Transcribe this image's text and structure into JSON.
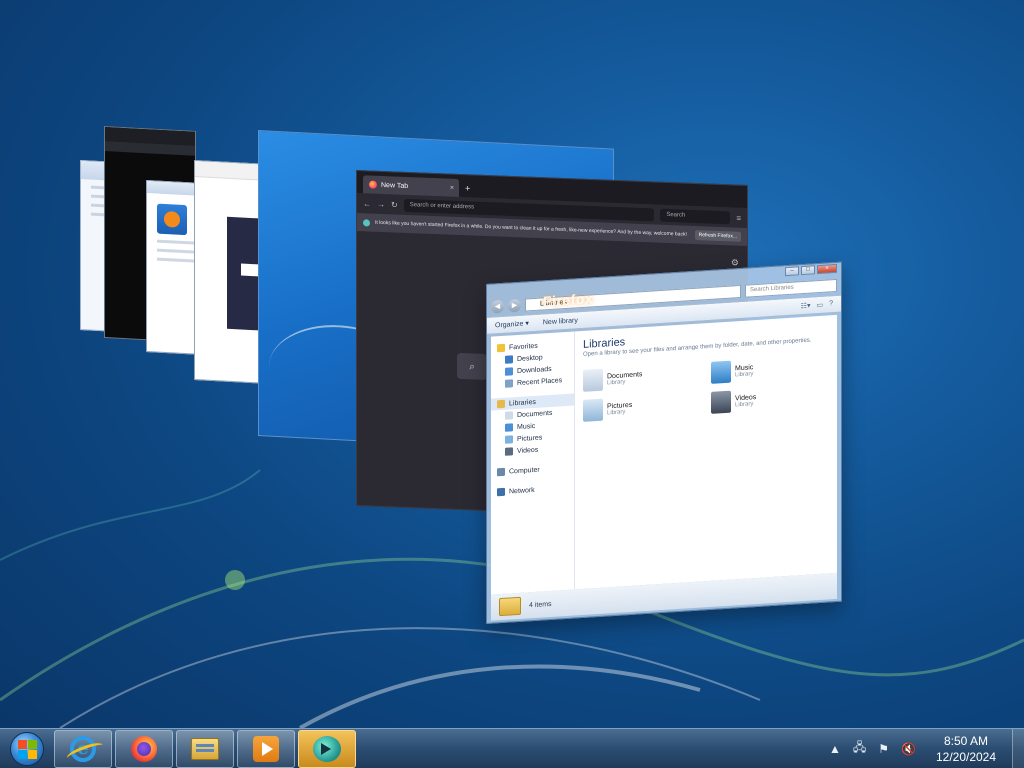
{
  "firefox_window": {
    "tab_title": "New Tab",
    "tab_close": "×",
    "new_tab": "+",
    "address_placeholder": "Search or enter address",
    "search_placeholder": "Search",
    "notification_text": "It looks like you haven't started Firefox in a while. Do you want to clean it up for a fresh, like-new experience? And by the way, welcome back!",
    "notification_button": "Refresh Firefox..."
  },
  "libraries_window": {
    "address": "Libraries",
    "search_placeholder": "Search Libraries",
    "overlay_logo": "Firefox",
    "commands": {
      "organize": "Organize ▾",
      "new_library": "New library"
    },
    "nav": {
      "favorites": "Favorites",
      "desktop": "Desktop",
      "downloads": "Downloads",
      "recent_places": "Recent Places",
      "libraries": "Libraries",
      "documents": "Documents",
      "music": "Music",
      "pictures": "Pictures",
      "videos": "Videos",
      "computer": "Computer",
      "network": "Network"
    },
    "heading": "Libraries",
    "subheading": "Open a library to see your files and arrange them by folder, date, and other properties.",
    "libraries": [
      {
        "name": "Documents",
        "type": "Library"
      },
      {
        "name": "Music",
        "type": "Library"
      },
      {
        "name": "Pictures",
        "type": "Library"
      },
      {
        "name": "Videos",
        "type": "Library"
      }
    ],
    "status": "4 items"
  },
  "taskbar": {
    "clock_time": "8:50 AM",
    "clock_date": "12/20/2024",
    "tray_arrow": "▲"
  },
  "colors": {
    "desktop": "#145a9c",
    "taskbar": "#2b4d72",
    "firefox_bg": "#2b2a33",
    "explorer_accent": "#1e3b6e"
  }
}
